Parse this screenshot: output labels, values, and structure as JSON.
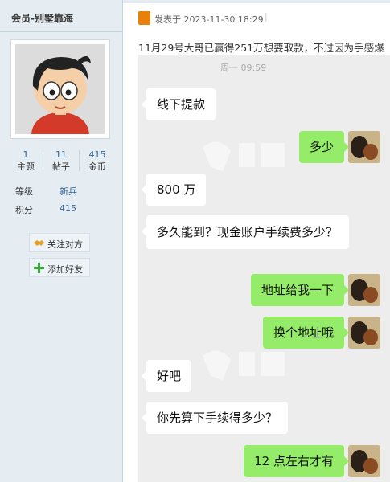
{
  "sidebar": {
    "username": "会员-别墅靠海",
    "stats": [
      {
        "value": "1",
        "label": "主题"
      },
      {
        "value": "11",
        "label": "帖子"
      },
      {
        "value": "415",
        "label": "金币"
      }
    ],
    "info": [
      {
        "label": "等级",
        "value": "新兵"
      },
      {
        "label": "积分",
        "value": "415"
      }
    ],
    "buttons": [
      {
        "label": "关注对方",
        "icon": "handshake-icon"
      },
      {
        "label": "添加好友",
        "icon": "plus-icon"
      }
    ]
  },
  "post": {
    "meta": "发表于 2023-11-30 18:29",
    "meta_separator": "|",
    "text": "11月29号大哥已赢得251万想要取款，不过因为手感爆",
    "icon": "post-icon"
  },
  "chat": {
    "time": "周一 09:59",
    "messages": [
      {
        "side": "left",
        "text": "线下提款"
      },
      {
        "side": "right",
        "text": "多少"
      },
      {
        "side": "left",
        "text": "800 万"
      },
      {
        "side": "left",
        "text": "多久能到？现金账户手续费多少？"
      },
      {
        "side": "right",
        "text": "地址给我一下"
      },
      {
        "side": "right",
        "text": "换个地址哦"
      },
      {
        "side": "left",
        "text": "好吧"
      },
      {
        "side": "left",
        "text": "你先算下手续得多少？"
      },
      {
        "side": "right",
        "text": "12 点左右才有"
      }
    ]
  },
  "colors": {
    "sidebar_bg": "#e5edf2",
    "chat_bg": "#ededed",
    "bubble_right": "#95ec69",
    "bubble_left": "#ffffff",
    "link": "#336699"
  }
}
